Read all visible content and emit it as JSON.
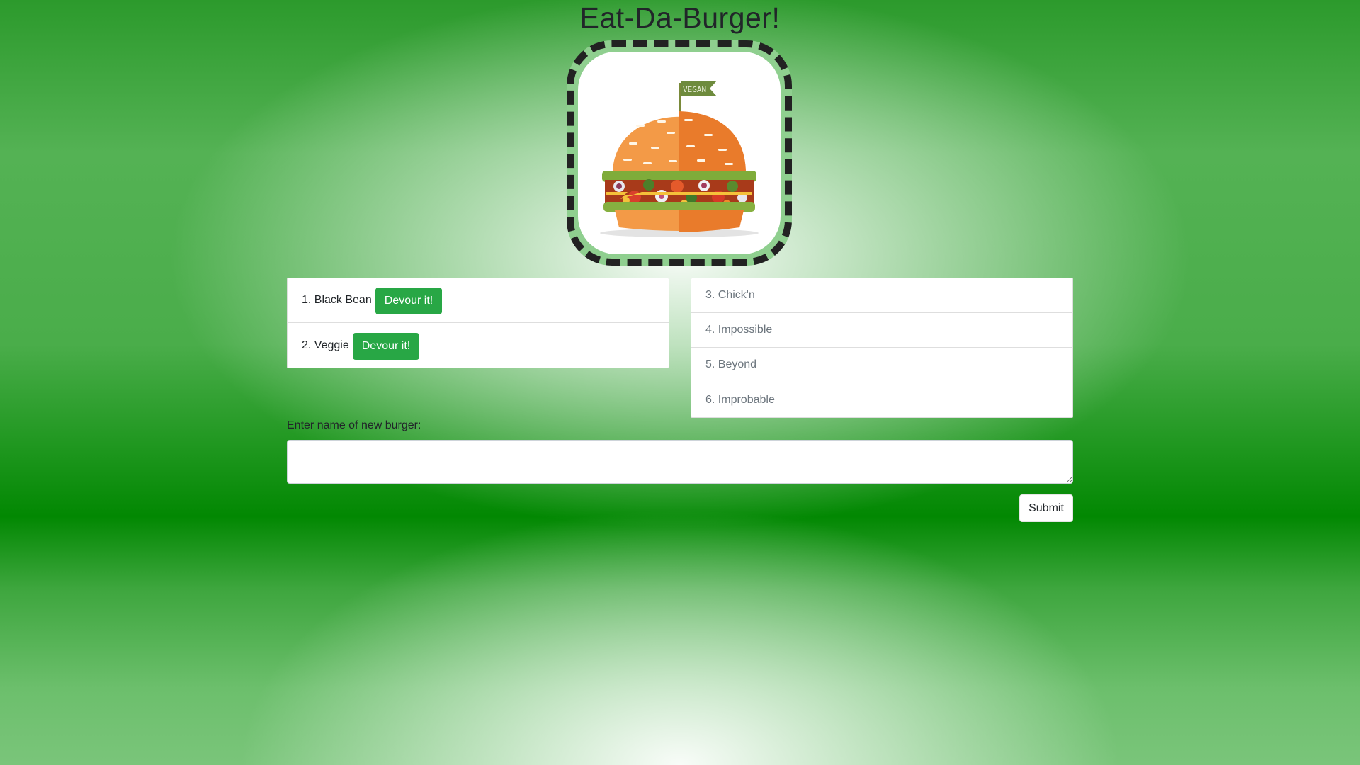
{
  "header": {
    "title": "Eat-Da-Burger!"
  },
  "logo": {
    "icon": "vegan-burger-logo",
    "flag_text": "VEGAN"
  },
  "uneaten": [
    {
      "label": "1. Black Bean",
      "button": "Devour it!"
    },
    {
      "label": "2. Veggie",
      "button": "Devour it!"
    }
  ],
  "devoured": [
    {
      "label": "3. Chick'n"
    },
    {
      "label": "4. Impossible"
    },
    {
      "label": "5. Beyond"
    },
    {
      "label": "6. Improbable"
    }
  ],
  "form": {
    "label": "Enter name of new burger:",
    "value": "",
    "submit_label": "Submit"
  },
  "colors": {
    "accent": "#28a745",
    "background_green": "#028802",
    "text": "#212529",
    "muted_text": "#6c757d"
  }
}
